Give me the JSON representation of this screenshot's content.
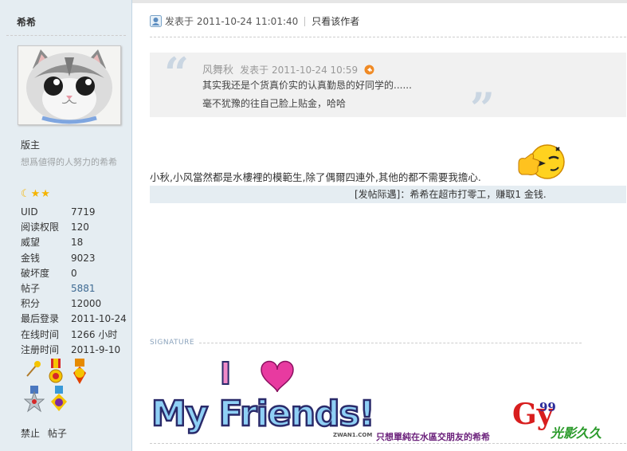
{
  "profile": {
    "username": "希希",
    "rank": "版主",
    "motto": "想爲値得的人努力的希希",
    "stars": "☾★★",
    "stats": [
      {
        "key": "UID",
        "value": "7719",
        "link": false
      },
      {
        "key": "阅读权限",
        "value": "120",
        "link": false
      },
      {
        "key": "威望",
        "value": "18",
        "link": false
      },
      {
        "key": "金钱",
        "value": "9023",
        "link": false
      },
      {
        "key": "破坏度",
        "value": "0",
        "link": false
      },
      {
        "key": "帖子",
        "value": "5881",
        "link": true
      },
      {
        "key": "积分",
        "value": "12000",
        "link": false
      },
      {
        "key": "最后登录",
        "value": "2011-10-24",
        "link": false
      },
      {
        "key": "在线时间",
        "value": "1266 小时",
        "link": false
      },
      {
        "key": "注册时间",
        "value": "2011-9-10",
        "link": false
      }
    ],
    "medal_icons": [
      "wand-medal-icon",
      "red-ribbon-medal-icon",
      "gold-qin-medal-icon",
      "silver-star-medal-icon",
      "purple-star-medal-icon"
    ],
    "actions": [
      "禁止",
      "帖子"
    ]
  },
  "post": {
    "posted_label": "发表于 2011-10-24 11:01:40",
    "author_only": "只看该作者",
    "quote": {
      "author": "风舞秋",
      "posted": "发表于 2011-10-24 10:59",
      "line1": "其实我还是个货真价实的认真勤恳的好同学的......",
      "line2": "毫不犹豫的往自己脸上贴金，哈哈"
    },
    "body": "小秋,小风當然都是水樓裡的模範生,除了偶爾四連外,其他的都不需要我擔心.",
    "notice": "[发帖际遇]：希希在超市打零工，赚取1 金钱."
  },
  "signature": {
    "label": "SIGNATURE",
    "banner_line1": "I",
    "banner_line2": "My Friends!",
    "small_mark": "ZWAN1.COM",
    "caption": "只想單純在水區交朋友的希希",
    "logo_letters": "Gy",
    "logo_number": "99",
    "logo_text": "光影久久"
  },
  "colors": {
    "sidebar_bg": "#e5edf2",
    "quote_bg": "#f1f1f1",
    "notice_bg": "#e5edf2",
    "link": "#3e6a93",
    "signature_caption": "#6a1f7a"
  }
}
